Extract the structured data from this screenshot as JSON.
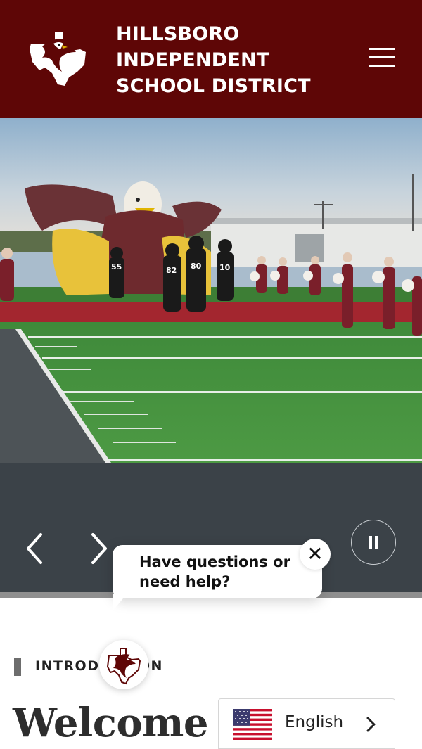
{
  "header": {
    "district_name": "HILLSBORO INDEPENDENT SCHOOL DISTRICT",
    "logo_icon": "eagle-texas-logo-icon",
    "menu_icon": "hamburger-menu-icon",
    "background_color": "#5e0606"
  },
  "hero": {
    "image_description_icon": "football-team-entrance-photo",
    "jersey_numbers": [
      "55",
      "82",
      "80",
      "10"
    ]
  },
  "slideshow": {
    "prev_icon": "chevron-left-icon",
    "next_icon": "chevron-right-icon",
    "pause_icon": "pause-icon"
  },
  "chat": {
    "prompt": "Have questions or need help?",
    "close_label": "✕"
  },
  "intro": {
    "label": "INTRODUCTION"
  },
  "welcome": {
    "heading": "Welcome t"
  },
  "language": {
    "selected": "English",
    "flag_icon": "us-flag-icon",
    "chevron_icon": "chevron-right-icon"
  },
  "colors": {
    "maroon": "#5e0606",
    "control_bar": "#3b4248"
  }
}
